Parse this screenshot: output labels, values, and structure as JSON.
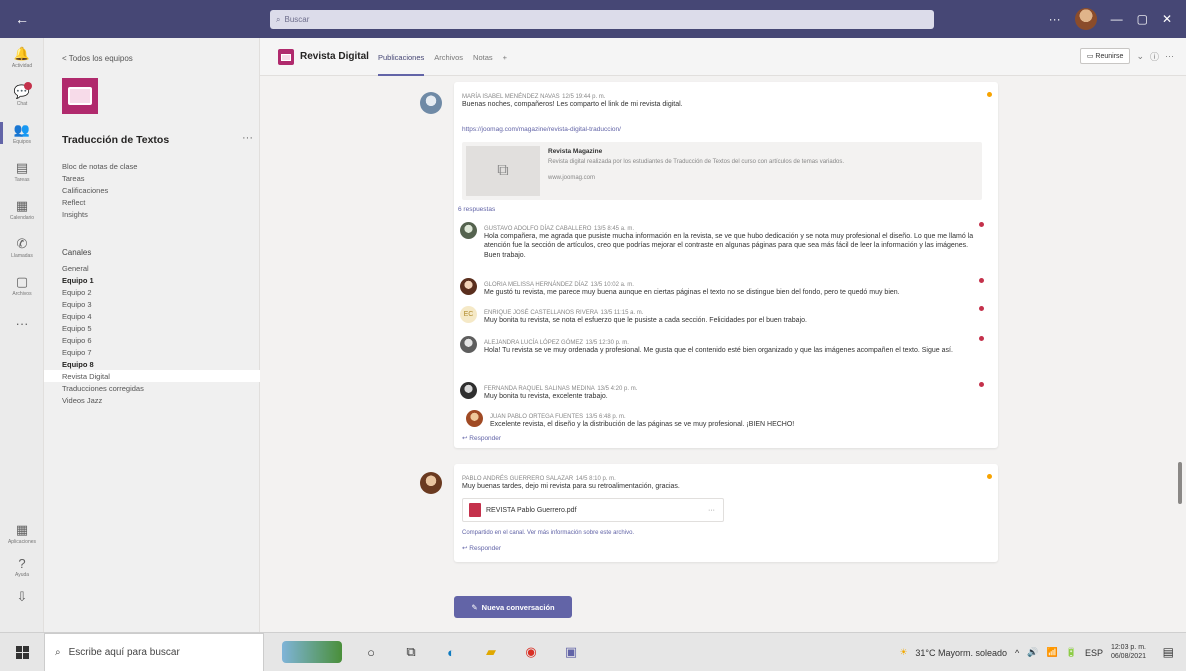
{
  "titlebar": {
    "back_icon": "arrow-left-icon",
    "search_placeholder": "Buscar",
    "window_buttons": [
      "—",
      "▢",
      "✕"
    ]
  },
  "rail": {
    "items": [
      {
        "label": "Actividad",
        "icon": "bell-icon"
      },
      {
        "label": "Chat",
        "icon": "chat-icon",
        "badge": true
      },
      {
        "label": "Equipos",
        "icon": "teams-icon",
        "active": true
      },
      {
        "label": "Tareas",
        "icon": "tasks-icon"
      },
      {
        "label": "Calendario",
        "icon": "calendar-icon"
      },
      {
        "label": "Llamadas",
        "icon": "phone-icon"
      },
      {
        "label": "Archivos",
        "icon": "files-icon"
      },
      {
        "label": "",
        "icon": "more-icon"
      }
    ],
    "bottom_items": [
      {
        "label": "Aplicaciones",
        "icon": "apps-icon"
      },
      {
        "label": "Ayuda",
        "icon": "help-icon"
      },
      {
        "label": "",
        "icon": "download-icon"
      }
    ]
  },
  "leftpane": {
    "back_text": "< Todos los equipos",
    "team_name": "Traducción de Textos",
    "team_more": "···",
    "nav_items": [
      "Bloc de notas de clase",
      "Tareas",
      "Calificaciones",
      "Reflect",
      "Insights"
    ],
    "channels_heading": "Canales",
    "channels": [
      {
        "label": "General",
        "bold": false,
        "selected": false
      },
      {
        "label": "Equipo 1",
        "bold": true,
        "selected": false
      },
      {
        "label": "Equipo 2",
        "bold": false,
        "selected": false
      },
      {
        "label": "Equipo 3",
        "bold": false,
        "selected": false
      },
      {
        "label": "Equipo 4",
        "bold": false,
        "selected": false
      },
      {
        "label": "Equipo 5",
        "bold": false,
        "selected": false
      },
      {
        "label": "Equipo 6",
        "bold": false,
        "selected": false
      },
      {
        "label": "Equipo 7",
        "bold": false,
        "selected": false
      },
      {
        "label": "Equipo 8",
        "bold": true,
        "selected": false
      },
      {
        "label": "Revista Digital",
        "bold": false,
        "selected": true
      },
      {
        "label": "Traducciones corregidas",
        "bold": false,
        "selected": false
      },
      {
        "label": "Videos Jazz",
        "bold": false,
        "selected": false
      }
    ]
  },
  "channel": {
    "name": "Revista Digital",
    "tabs": [
      "Publicaciones",
      "Archivos",
      "Notas",
      "+"
    ],
    "meet_label": "Reunirse",
    "header_icons": [
      "chevron-down-icon",
      "info-icon",
      "more-icon"
    ]
  },
  "posts": [
    {
      "author": "MARÍA ISABEL MENÉNDEZ NAVAS",
      "time": "12/5 19:44 p. m.",
      "text": "Buenas noches, compañeros! Les comparto el link de mi revista digital.",
      "link": "https://joomag.com/magazine/revista-digital-traduccion/",
      "preview_title": "Revista Magazine",
      "preview_desc": "Revista digital realizada por los estudiantes de Traducción de Textos del curso con artículos de temas variados.",
      "preview_url": "www.joomag.com",
      "replies_label": "6 respuestas",
      "replies": [
        {
          "author": "GUSTAVO ADOLFO DÍAZ CABALLERO",
          "time": "13/5 8:45 a. m.",
          "text": "Hola compañera, me agrada que pusiste mucha información en la revista, se ve que hubo dedicación y se nota muy profesional el diseño. Lo que me llamó la atención fue la sección de artículos, creo que podrías mejorar el contraste en algunas páginas para que sea más fácil de leer la información y las imágenes. Buen trabajo."
        },
        {
          "author": "GLORIA MELISSA HERNÁNDEZ DÍAZ",
          "time": "13/5 10:02 a. m.",
          "text": "Me gustó tu revista, me parece muy buena aunque en ciertas páginas el texto no se distingue bien del fondo, pero te quedó muy bien."
        },
        {
          "author": "ENRIQUE JOSÉ CASTELLANOS RIVERA",
          "time": "13/5 11:15 a. m.",
          "text": "Muy bonita tu revista, se nota el esfuerzo que le pusiste a cada sección. Felicidades por el buen trabajo."
        },
        {
          "author": "ALEJANDRA LUCÍA LÓPEZ GÓMEZ",
          "time": "13/5 12:30 p. m.",
          "text": "Hola! Tu revista se ve muy ordenada y profesional. Me gusta que el contenido esté bien organizado y que las imágenes acompañen el texto. Sigue así."
        },
        {
          "author": "FERNANDA RAQUEL SALINAS MEDINA",
          "time": "13/5 4:20 p. m.",
          "text": "Muy bonita tu revista, excelente trabajo."
        },
        {
          "author": "JUAN PABLO ORTEGA FUENTES",
          "time": "13/5 6:48 p. m.",
          "text": "Excelente revista, el diseño y la distribución de las páginas se ve muy profesional. ¡BIEN HECHO!"
        }
      ],
      "reply_action": "Responder"
    },
    {
      "author": "PABLO ANDRÉS GUERRERO SALAZAR",
      "time": "14/5 8:10 p. m.",
      "text": "Muy buenas tardes, dejo mi revista para su retroalimentación, gracias.",
      "file_name": "REVISTA Pablo Guerrero.pdf",
      "file_more": "···",
      "footer_link": "Compartido en el canal. Ver más información sobre este archivo.",
      "reply_action": "Responder"
    }
  ],
  "new_conversation_label": "Nueva conversación",
  "taskbar": {
    "search_placeholder": "Escribe aquí para buscar",
    "apps": [
      "cortana-icon",
      "task-view-icon",
      "edge-icon",
      "files-icon",
      "chrome-icon",
      "teams-icon"
    ],
    "weather": "31°C  Mayorm. soleado",
    "tray_icons": [
      "^",
      "🔊",
      "📶",
      "🔋"
    ],
    "language": "ESP",
    "time": "12:03 p. m.",
    "date": "06/08/2021"
  }
}
